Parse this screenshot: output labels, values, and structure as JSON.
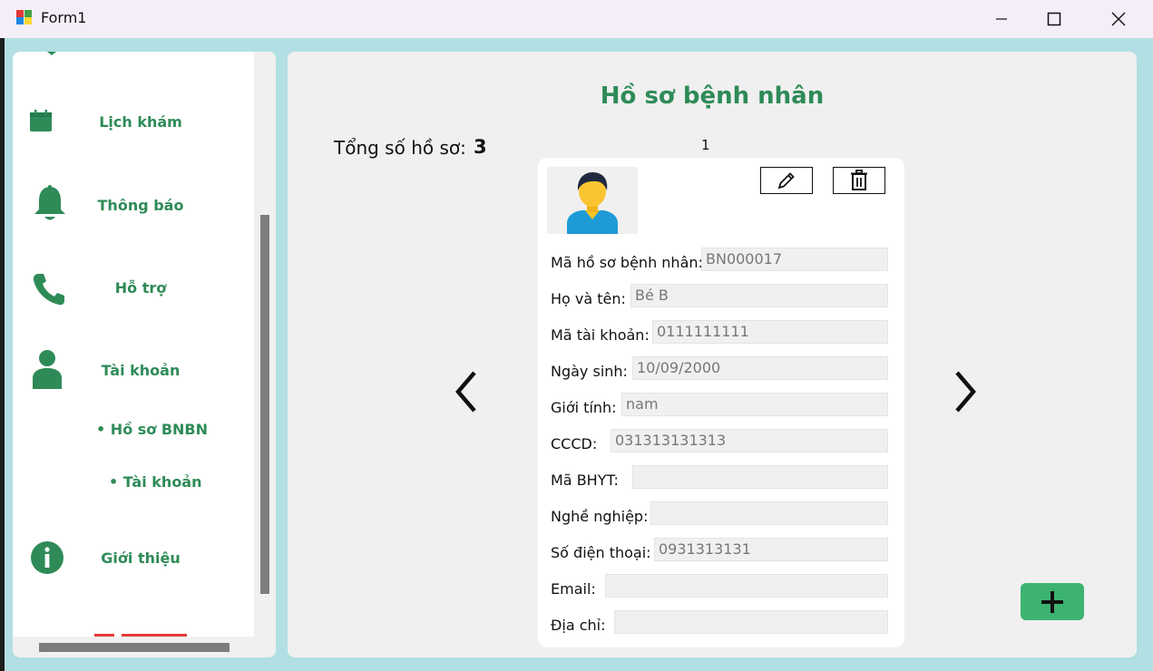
{
  "window": {
    "title": "Form1"
  },
  "sidebar": {
    "items": [
      {
        "label": "Lịch khám",
        "icon": "calendar-icon"
      },
      {
        "label": "Thông báo",
        "icon": "bell-icon"
      },
      {
        "label": "Hỗ trợ",
        "icon": "phone-icon"
      },
      {
        "label": "Tài khoản",
        "icon": "user-icon"
      },
      {
        "label": "Giới thiệu",
        "icon": "info-icon"
      }
    ],
    "subitems": [
      {
        "label": "• Hồ sơ BNBN"
      },
      {
        "label": "• Tài khoản"
      }
    ]
  },
  "main": {
    "title": "Hồ sơ bệnh nhân",
    "total_label": "Tổng số hồ sơ:",
    "total_value": "3",
    "current_index": "1"
  },
  "card": {
    "fields": [
      {
        "label": "Mã hồ sơ bệnh nhân:",
        "value": "BN000017"
      },
      {
        "label": "Họ và tên:",
        "value": "Bé B"
      },
      {
        "label": "Mã tài khoản:",
        "value": "0111111111"
      },
      {
        "label": "Ngày sinh:",
        "value": "10/09/2000"
      },
      {
        "label": "Giới tính:",
        "value": "nam"
      },
      {
        "label": "CCCD:",
        "value": "031313131313"
      },
      {
        "label": "Mã BHYT:",
        "value": ""
      },
      {
        "label": "Nghề nghiệp:",
        "value": ""
      },
      {
        "label": "Số điện thoại:",
        "value": "0931313131"
      },
      {
        "label": "Email:",
        "value": ""
      },
      {
        "label": "Địa chỉ:",
        "value": ""
      }
    ]
  },
  "colors": {
    "accent": "#2e8b57",
    "add_button": "#3cb371",
    "background": "#b2dfe3"
  }
}
